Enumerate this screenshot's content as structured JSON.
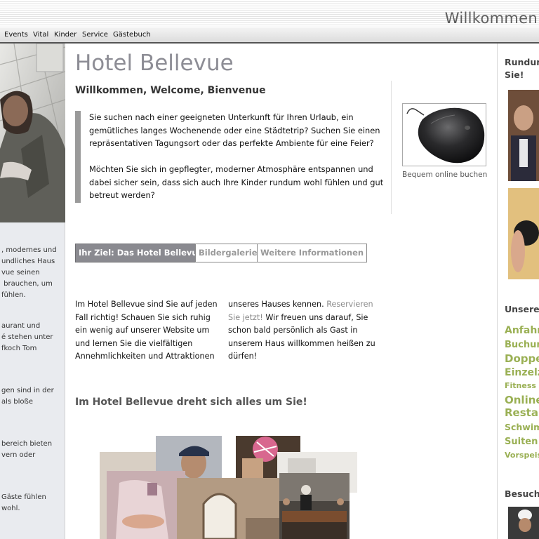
{
  "header": {
    "title": "Willkommen"
  },
  "nav": {
    "items": [
      "Events",
      "Vital",
      "Kinder",
      "Service",
      "Gästebuch"
    ]
  },
  "left": {
    "blocks": [
      ", modernes und\nundliches Haus\nvue seinen\n brauchen, um\nfühlen.",
      "aurant und\né stehen unter\nfkoch Tom",
      "gen sind in der\nals bloße",
      "bereich bieten\nvern oder",
      "Gäste fühlen\nwohl."
    ]
  },
  "main": {
    "hotel_name": "Hotel Bellevue",
    "welcome_line": "Willkommen, Welcome, Bienvenue",
    "intro_1": "Sie suchen nach einer geeigneten Unterkunft für Ihren Urlaub, ein gemütliches langes Wochenende oder eine Städtetrip? Suchen Sie einen repräsentativen Tagungsort oder das perfekte Ambiente für eine Feier?",
    "intro_2": "Möchten Sie sich in gepflegter, moderner Atmosphäre entspannen und dabei sicher sein, dass sich auch Ihre Kinder rundum wohl fühlen und gut betreut werden?",
    "tabs": [
      "Ihr Ziel: Das Hotel Bellevue",
      "Bildergalerie",
      "Weitere Informationen"
    ],
    "para_left": "Im Hotel Bellevue sind Sie auf jeden\nFall richtig! Schauen Sie sich ruhig\nein wenig auf unserer Website um\nund lernen Sie die vielfältigen\nAnnehmlichkeiten und Attraktionen",
    "para_right_1": "unseres Hauses kennen. ",
    "para_right_link_1": "Reservieren",
    "para_right_link_2": "Sie jetzt!",
    "para_right_2": " Wir freuen uns darauf, Sie\nschon bald persönlich als Gast in\nunserem Haus willkommen heißen zu\ndürfen!",
    "dreht": "Im Hotel Bellevue dreht sich alles um Sie!"
  },
  "promo": {
    "caption": "Bequem online buchen"
  },
  "right": {
    "heading_1": "Rundum",
    "heading_1b": "Sie!",
    "heading_2": "Unsere I",
    "links": [
      "Anfahrt",
      "Buchung",
      "Doppel",
      "Einzelzi",
      "Fitness G",
      "Online-",
      "Restau",
      "Schwimm",
      "Suiten T",
      "Vorspeise"
    ],
    "heading_3": "Besuche"
  },
  "colors": {
    "accent_green": "#9ab054",
    "tab_active": "#8a8a90",
    "title_gray": "#8d8d95"
  }
}
